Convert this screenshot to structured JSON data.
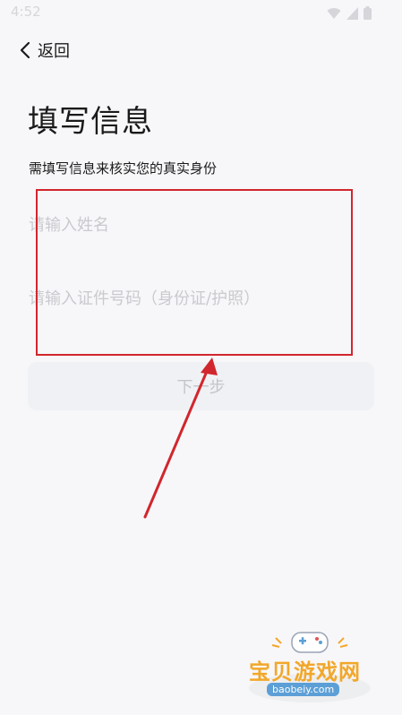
{
  "status_bar": {
    "time": "4:52"
  },
  "nav": {
    "back_label": "返回"
  },
  "page": {
    "title": "填写信息",
    "subtitle": "需填写信息来核实您的真实身份"
  },
  "form": {
    "name_placeholder": "请输入姓名",
    "id_placeholder": "请输入证件号码（身份证/护照）",
    "next_label": "下一步"
  },
  "watermark": {
    "name": "宝贝游戏网",
    "url": "baobeiy.com"
  },
  "colors": {
    "annotation": "#d1262d",
    "background": "#f7f7f9",
    "placeholder": "#c9cacf",
    "button_bg": "#f0f1f4"
  }
}
